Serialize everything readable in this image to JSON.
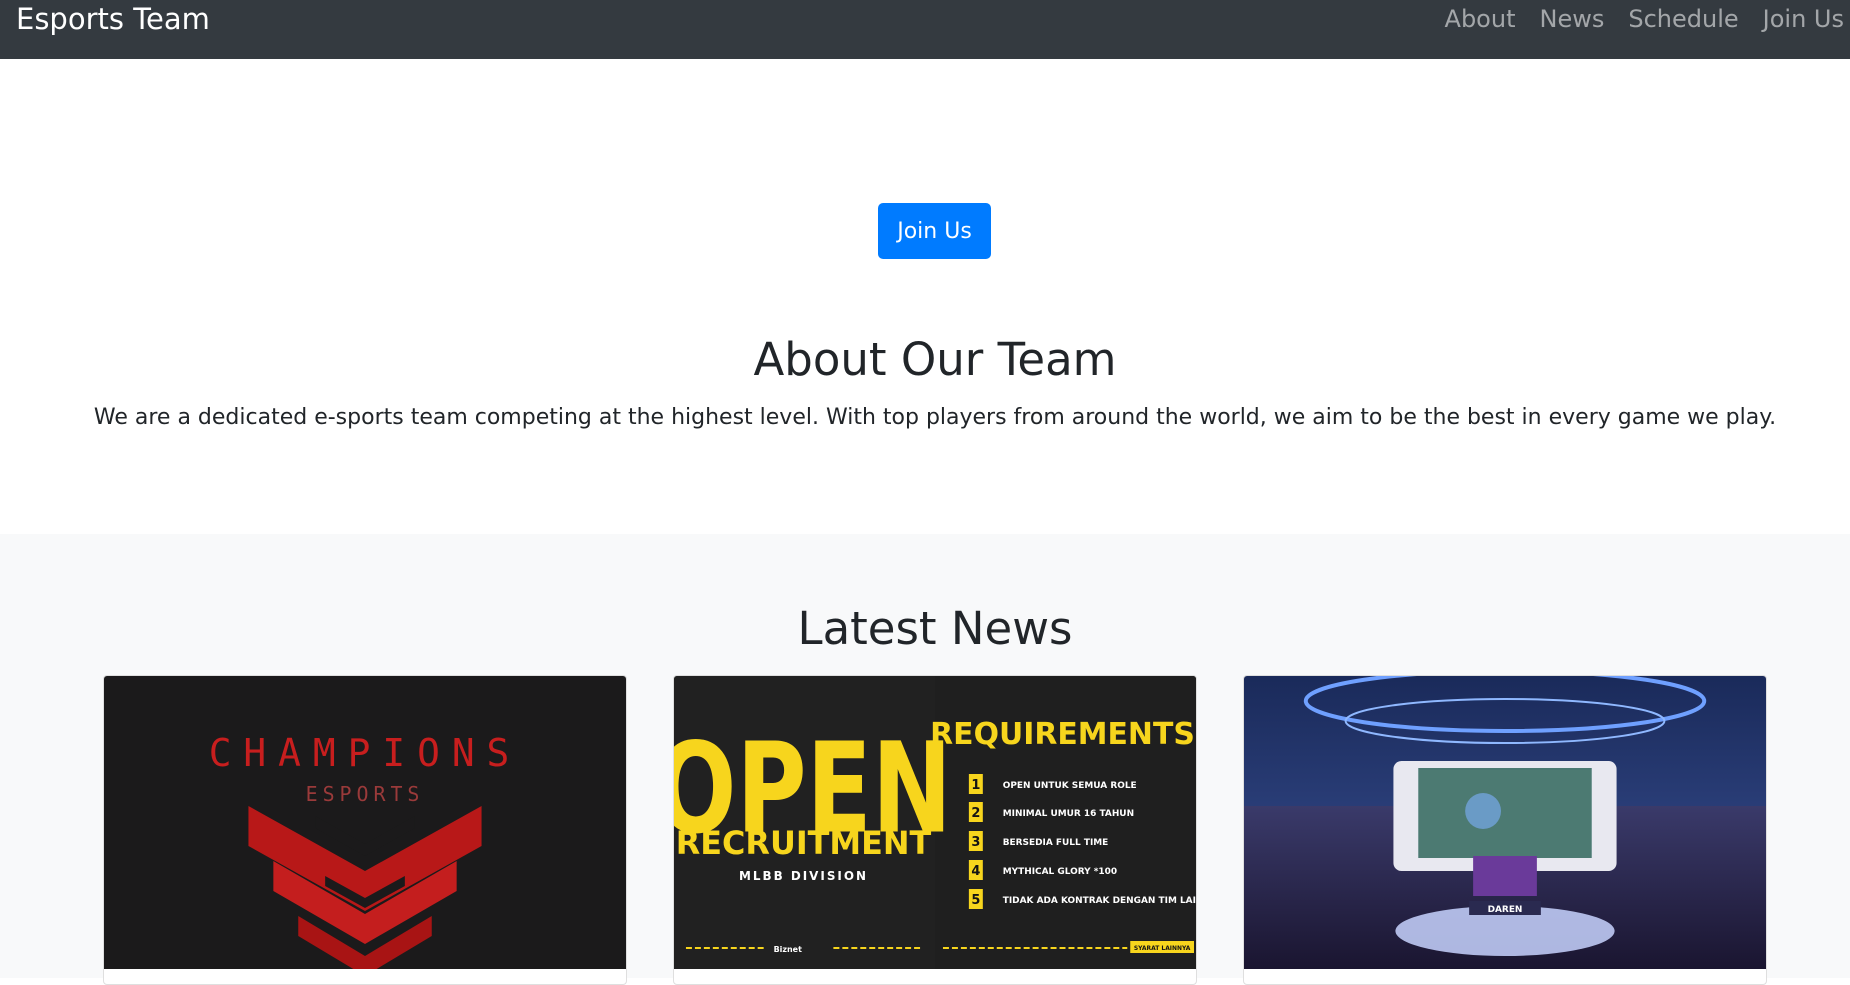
{
  "navbar": {
    "brand": "Esports Team",
    "links": [
      "About",
      "News",
      "Schedule",
      "Join Us"
    ]
  },
  "hero": {
    "join_button": "Join Us",
    "about_title": "About Our Team",
    "about_text": "We are a dedicated e-sports team competing at the highest level. With top players from around the world, we aim to be the best in every game we play."
  },
  "news": {
    "title": "Latest News",
    "cards": [
      {
        "image": {
          "title": "CHAMPIONS",
          "subtitle": "ESPORTS"
        }
      },
      {
        "image": {
          "open": "OPEN",
          "recruitment": "RECRUITMENT",
          "division": "MLBB DIVISION",
          "requirements_title": "REQUIREMENTS",
          "requirements": [
            "OPEN UNTUK SEMUA ROLE",
            "MINIMAL UMUR 16 TAHUN",
            "BERSEDIA FULL TIME",
            "MYTHICAL GLORY *100",
            "TIDAK ADA KONTRAK DENGAN TIM LAIN"
          ],
          "numbers": [
            "1",
            "2",
            "3",
            "4",
            "5"
          ],
          "footer_right": "SYARAT LAINNYA",
          "sponsor": "Biznet"
        }
      },
      {
        "image": {
          "stage_label": "DAREN"
        }
      }
    ]
  },
  "colors": {
    "navbar_bg": "#343a40",
    "primary": "#007bff",
    "champions_red": "#c81e1e",
    "recruit_yellow": "#f7d51d"
  }
}
